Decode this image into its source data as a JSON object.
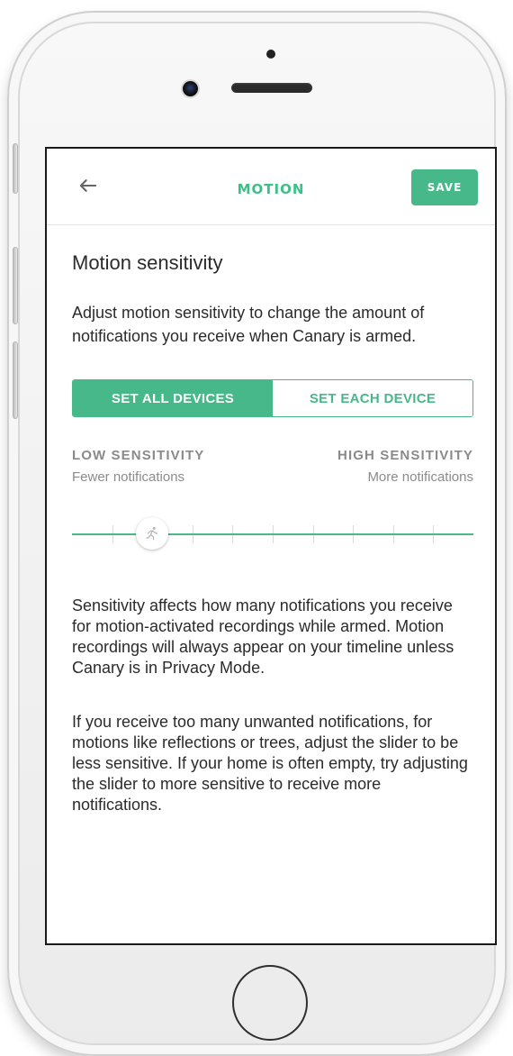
{
  "header": {
    "title": "MOTION",
    "save_label": "SAVE"
  },
  "main": {
    "heading": "Motion sensitivity",
    "intro": "Adjust motion sensitivity to change the amount of notifications you receive when Canary is armed.",
    "segmented": [
      {
        "label": "SET ALL DEVICES",
        "active": true
      },
      {
        "label": "SET EACH DEVICE",
        "active": false
      }
    ],
    "sensitivity": {
      "low_label": "LOW SENSITIVITY",
      "low_sub": "Fewer notifications",
      "high_label": "HIGH SENSITIVITY",
      "high_sub": "More notifications",
      "level": 2,
      "max_level": 10
    },
    "paragraphs": [
      "Sensitivity affects how many notifications you receive for motion-activated recordings while armed. Motion recordings will always appear on your timeline unless Canary is in Privacy Mode.",
      "If you receive too many unwanted notifications, for motions like reflections or trees, adjust the slider to be less sensitive. If your home is often empty, try adjusting the slider to more sensitive to receive more notifications."
    ]
  },
  "icons": {
    "back": "arrow-left-icon",
    "slider_thumb": "running-person-icon",
    "home_button": "home-button-icon"
  },
  "colors": {
    "accent": "#47b889",
    "text": "#2b2b2b",
    "muted": "#8a8a8a"
  }
}
